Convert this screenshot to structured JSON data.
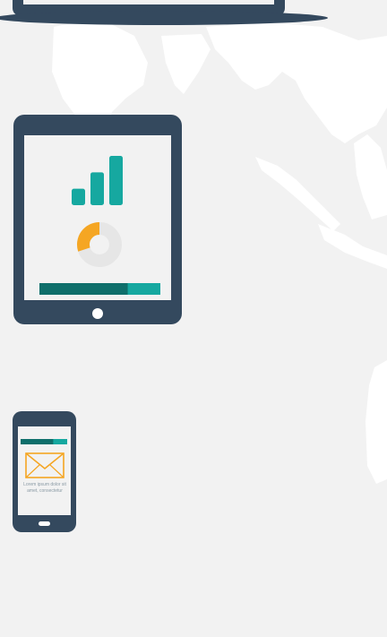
{
  "colors": {
    "background": "#f2f2f2",
    "map_land": "#ffffff",
    "device_body": "#34495e",
    "screen": "#f2f2f2",
    "teal": "#16a8a0",
    "dark_teal": "#0f6f6b",
    "orange": "#f5a623",
    "light_gray": "#e6e6e6"
  },
  "icons": {
    "laptop": "laptop-icon",
    "tablet": "tablet-icon",
    "phone": "smartphone-icon",
    "bar_chart": "bar-chart-icon",
    "donut": "donut-chart-icon",
    "envelope": "envelope-icon"
  },
  "tablet": {
    "bar_chart_values": [
      1,
      2,
      3
    ],
    "donut_fraction": 0.3,
    "progress_fraction": 0.73
  },
  "phone": {
    "progress_fraction": 0.7,
    "body_text": "Lorem ipsum dolor sit amet, consectetur"
  }
}
